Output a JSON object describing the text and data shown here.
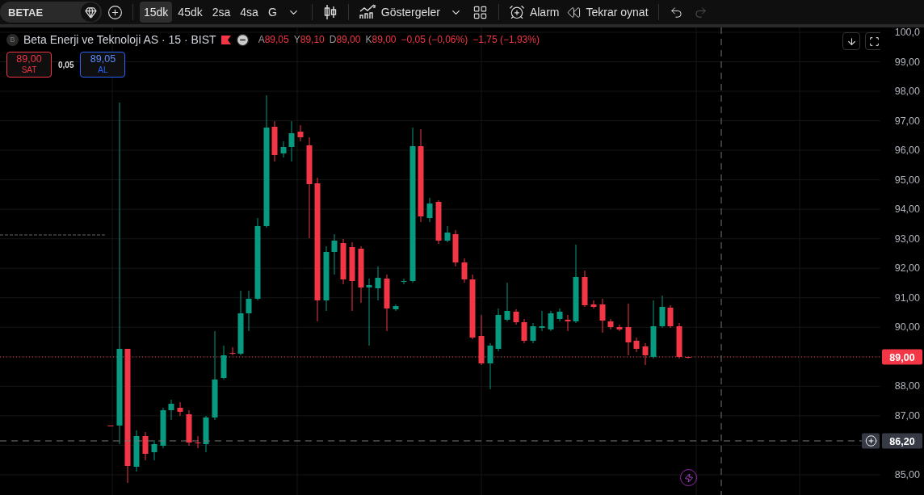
{
  "toolbar": {
    "symbol": "BETAE",
    "intervals": [
      {
        "label": "15dk",
        "selected": true
      },
      {
        "label": "45dk",
        "selected": false
      },
      {
        "label": "2sa",
        "selected": false
      },
      {
        "label": "4sa",
        "selected": false
      },
      {
        "label": "G",
        "selected": false
      }
    ],
    "indicators": "Göstergeler",
    "alarm": "Alarm",
    "replay": "Tekrar oynat",
    "undo": {
      "disabled": false
    },
    "redo": {
      "disabled": true
    }
  },
  "legend": {
    "logo_letter": "B",
    "title": "Beta Enerji ve Teknoloji AS · 15 · BIST",
    "ohlc": [
      {
        "key": "A",
        "value": "89,05"
      },
      {
        "key": "Y",
        "value": "89,10"
      },
      {
        "key": "D",
        "value": "89,00"
      },
      {
        "key": "K",
        "value": "89,00"
      }
    ],
    "change": "−0,05 (−0,06%)",
    "change_total": "−1,75 (−1,93%)"
  },
  "trade": {
    "sell": {
      "price": "89,00",
      "label": "SAT"
    },
    "spread": "0,05",
    "buy": {
      "price": "89,05",
      "label": "AL"
    }
  },
  "price_axis": {
    "labels_upper": [
      "100,0",
      "99,00",
      "98,00",
      "97,00",
      "96,00",
      "95,00",
      "94,00",
      "93,00",
      "92,00",
      "91,00",
      "90,00"
    ],
    "labels_middle": [
      "88,00",
      "87,00"
    ],
    "labels_lower": [
      "85,00"
    ],
    "last_price": "89,00",
    "crosshair_price": "86,20"
  }
}
